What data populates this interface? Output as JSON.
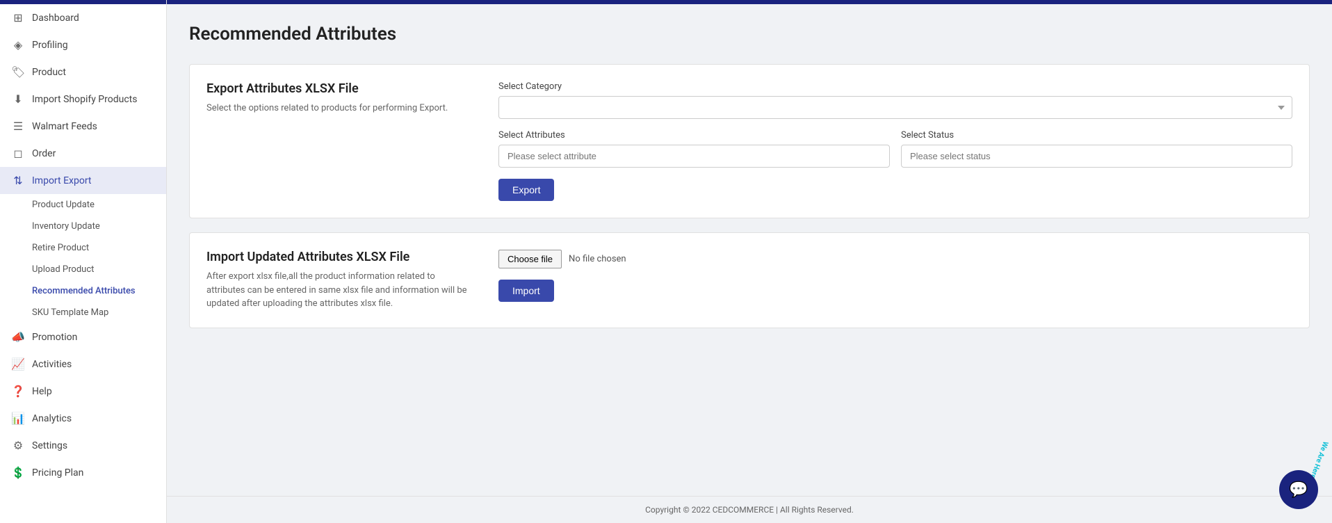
{
  "sidebar": {
    "items": [
      {
        "id": "dashboard",
        "label": "Dashboard",
        "icon": "⊞",
        "active": false
      },
      {
        "id": "profiling",
        "label": "Profiling",
        "icon": "◈",
        "active": false
      },
      {
        "id": "product",
        "label": "Product",
        "icon": "🏷",
        "active": false
      },
      {
        "id": "import-shopify",
        "label": "Import Shopify Products",
        "icon": "⬇",
        "active": false
      },
      {
        "id": "walmart-feeds",
        "label": "Walmart Feeds",
        "icon": "☰",
        "active": false
      },
      {
        "id": "order",
        "label": "Order",
        "icon": "◻",
        "active": false
      },
      {
        "id": "import-export",
        "label": "Import Export",
        "icon": "⇅",
        "active": true
      },
      {
        "id": "promotion",
        "label": "Promotion",
        "icon": "📣",
        "active": false
      },
      {
        "id": "activities",
        "label": "Activities",
        "icon": "📈",
        "active": false
      },
      {
        "id": "help",
        "label": "Help",
        "icon": "❓",
        "active": false
      },
      {
        "id": "analytics",
        "label": "Analytics",
        "icon": "📊",
        "active": false
      },
      {
        "id": "settings",
        "label": "Settings",
        "icon": "⚙",
        "active": false
      },
      {
        "id": "pricing-plan",
        "label": "Pricing Plan",
        "icon": "💲",
        "active": false
      }
    ],
    "subitems": [
      {
        "id": "product-update",
        "label": "Product Update",
        "active": false
      },
      {
        "id": "inventory-update",
        "label": "Inventory Update",
        "active": false
      },
      {
        "id": "retire-product",
        "label": "Retire Product",
        "active": false
      },
      {
        "id": "upload-product",
        "label": "Upload Product",
        "active": false
      },
      {
        "id": "recommended-attributes",
        "label": "Recommended Attributes",
        "active": true
      },
      {
        "id": "sku-template-map",
        "label": "SKU Template Map",
        "active": false
      }
    ]
  },
  "page": {
    "title": "Recommended Attributes"
  },
  "export_section": {
    "title": "Export Attributes XLSX File",
    "description": "Select the options related to products for performing Export.",
    "select_category_label": "Select Category",
    "select_category_placeholder": "",
    "select_attributes_label": "Select Attributes",
    "select_attributes_placeholder": "Please select attribute",
    "select_status_label": "Select Status",
    "select_status_placeholder": "Please select status",
    "export_button_label": "Export"
  },
  "import_section": {
    "title": "Import Updated Attributes XLSX File",
    "description": "After export xlsx file,all the product information related to attributes can be entered in same xlsx file and information will be updated after uploading the attributes xlsx file.",
    "choose_file_label": "Choose file",
    "no_file_chosen_label": "No file chosen",
    "import_button_label": "Import"
  },
  "footer": {
    "copyright": "Copyright © 2022 CEDCOMMERCE | All Rights Reserved."
  },
  "chat": {
    "we_are_here": "We Are Here!",
    "icon": "💬"
  }
}
